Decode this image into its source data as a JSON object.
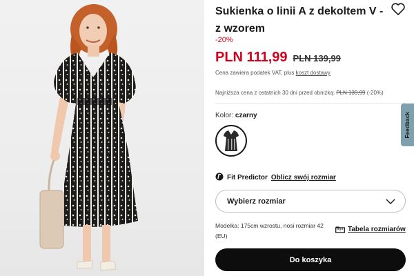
{
  "product": {
    "title": "Sukienka o linii A z dekoltem V - z wzorem",
    "discount": "-20%",
    "price_new": "PLN 111,99",
    "price_old": "PLN 139,99",
    "vat_text": "Cena zawiera podatek VAT, plus ",
    "vat_link": "koszt dostawy",
    "lowest_prefix": "Najniższa cena z ostatnich 30 dni przed obniżką: ",
    "lowest_price": "PLN 139,99",
    "lowest_suffix": " (-20%)"
  },
  "color": {
    "label": "Kolor:",
    "value": "czarny"
  },
  "fit": {
    "label": "Fit Predictor",
    "link": "Oblicz swój rozmiar"
  },
  "size": {
    "placeholder": "Wybierz rozmiar"
  },
  "model_info": "Modelka: 175cm wzrostu, nosi rozmiar 42 (EU)",
  "size_table": "Tabela rozmiarów",
  "cart_button": "Do koszyka",
  "feedback": "Feedback",
  "colors": {
    "price_red": "#d0021b",
    "button_black": "#0d0d0d",
    "feedback_tab": "#7fa1ad"
  },
  "icons": {
    "favorite": "heart-icon",
    "fit": "fit-predictor-icon",
    "chevron": "chevron-down-icon",
    "size_table": "ruler-icon"
  }
}
